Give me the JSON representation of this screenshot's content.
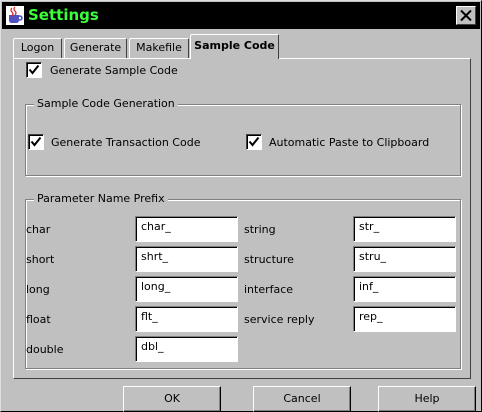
{
  "window": {
    "title": "Settings",
    "close_label": "Close"
  },
  "tabs": [
    {
      "label": "Logon",
      "active": false
    },
    {
      "label": "Generate",
      "active": false
    },
    {
      "label": "Makefile",
      "active": false
    },
    {
      "label": "Sample Code",
      "active": true
    }
  ],
  "generate_sample_code": {
    "label": "Generate Sample Code",
    "checked": true
  },
  "sample_code_generation": {
    "title": "Sample Code Generation",
    "transaction_code": {
      "label": "Generate Transaction Code",
      "checked": true
    },
    "auto_paste": {
      "label": "Automatic Paste to Clipboard",
      "checked": true
    }
  },
  "parameter_prefix": {
    "title": "Parameter Name Prefix",
    "left": [
      {
        "label": "char",
        "value": "char_"
      },
      {
        "label": "short",
        "value": "shrt_"
      },
      {
        "label": "long",
        "value": "long_"
      },
      {
        "label": "float",
        "value": "flt_"
      },
      {
        "label": "double",
        "value": "dbl_"
      }
    ],
    "right": [
      {
        "label": "string",
        "value": "str_"
      },
      {
        "label": "structure",
        "value": "stru_"
      },
      {
        "label": "interface",
        "value": "inf_"
      },
      {
        "label": "service reply",
        "value": "rep_"
      }
    ]
  },
  "buttons": {
    "ok": "OK",
    "cancel": "Cancel",
    "help": "Help"
  },
  "colors": {
    "title_text": "#3cff3c",
    "titlebar": "#000000",
    "face": "#c0c0c0"
  }
}
